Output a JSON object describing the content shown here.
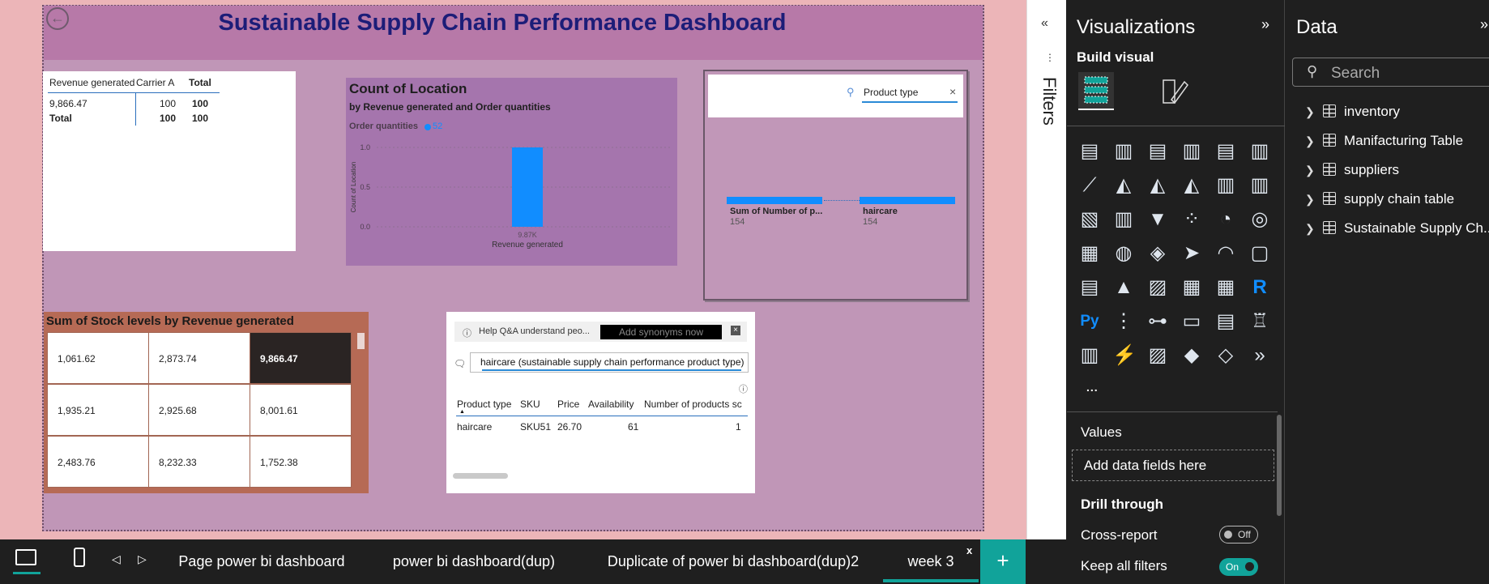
{
  "dashboard": {
    "title": "Sustainable Supply Chain Performance Dashboard",
    "back_icon": "back-arrow-icon"
  },
  "table_visual": {
    "headers": [
      "Revenue generated",
      "Carrier A",
      "Total"
    ],
    "rows": [
      [
        "9,866.47",
        "100",
        "100"
      ],
      [
        "Total",
        "100",
        "100"
      ]
    ]
  },
  "chart_visual": {
    "title": "Count of Location",
    "subtitle": "by Revenue generated and Order quantities",
    "legend_title": "Order quantities",
    "legend_item": "52",
    "series_color": "#118dff"
  },
  "chart_data": {
    "type": "bar",
    "title": "Count of Location",
    "subtitle": "by Revenue generated and Order quantities",
    "xlabel": "Revenue generated",
    "ylabel": "Count of Location",
    "categories": [
      "9.87K"
    ],
    "series": [
      {
        "name": "52",
        "values": [
          1
        ]
      }
    ],
    "y_ticks": [
      "1.0",
      "0.5",
      "0.0"
    ],
    "ylim": [
      0,
      1
    ],
    "grid": true,
    "legend": "top-left"
  },
  "funnel_visual": {
    "slicer_label": "Product type",
    "slicer_clear": "×",
    "bars": [
      {
        "label": "Sum of Number of p...",
        "value": "154"
      },
      {
        "label": "haircare",
        "value": "154"
      }
    ]
  },
  "stock_visual": {
    "title": "Sum of Stock levels by Revenue generated",
    "cells": [
      [
        "1,061.62",
        "2,873.74",
        "9,866.47"
      ],
      [
        "1,935.21",
        "2,925.68",
        "8,001.61"
      ],
      [
        "2,483.76",
        "8,232.33",
        "1,752.38"
      ]
    ]
  },
  "qa_visual": {
    "help_text": "Help Q&A understand peo...",
    "synonyms_button": "Add synonyms now",
    "close": "×",
    "question": "haircare (sustainable supply chain performance product type)",
    "headers": [
      "Product type",
      "SKU",
      "Price",
      "Availability",
      "Number of products sc"
    ],
    "row": [
      "haircare",
      "SKU51",
      "26.70",
      "61",
      "1"
    ]
  },
  "filters": {
    "label": "Filters",
    "collapse_icon": "double-chevron-left-icon"
  },
  "visualizations_pane": {
    "title": "Visualizations",
    "expand_icon": "double-chevron-right-icon",
    "build_visual": "Build visual",
    "more": "...",
    "values_label": "Values",
    "add_fields": "Add data fields here",
    "drill_through": "Drill through",
    "cross_report": "Cross-report",
    "cross_report_state": "Off",
    "keep_filters": "Keep all filters",
    "keep_filters_state": "On",
    "accent": "#118dff"
  },
  "data_pane": {
    "title": "Data",
    "search_placeholder": "Search",
    "tables": [
      "inventory",
      "Manifacturing Table",
      "suppliers",
      "supply chain table",
      "Sustainable Supply Ch..."
    ]
  },
  "tab_bar": {
    "pages": [
      "Page power bi dashboard",
      "power bi dashboard(dup)",
      "Duplicate of power bi dashboard(dup)2",
      "week 3"
    ],
    "active_page": "week 3",
    "close": "x",
    "add": "+",
    "accent": "#11a39a"
  }
}
